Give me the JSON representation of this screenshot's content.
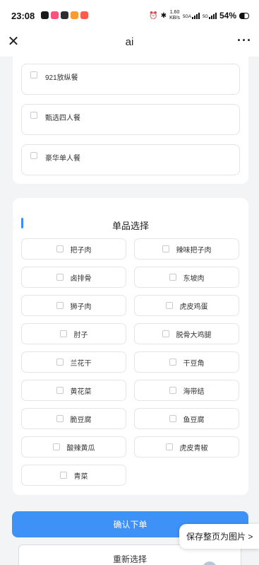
{
  "status_bar": {
    "time": "23:08",
    "net_speed": "1.60",
    "net_unit": "KB/s",
    "net_5ga": "5GA",
    "net_5g": "5G",
    "battery": "54%",
    "app_icon_colors": [
      "#1a1a1a",
      "#ff4f7a",
      "#2d2d2d",
      "#ff9a2e",
      "#ff5a4a"
    ]
  },
  "nav": {
    "title": "ai",
    "close_icon": "close-icon",
    "more_icon": "more-icon"
  },
  "combos": {
    "items": [
      {
        "label": "921放纵餐"
      },
      {
        "label": "甄选四人餐"
      },
      {
        "label": "豪华单人餐"
      }
    ]
  },
  "single": {
    "title": "单品选择",
    "items": [
      {
        "label": "把子肉"
      },
      {
        "label": "辣味把子肉"
      },
      {
        "label": "卤排骨"
      },
      {
        "label": "东坡肉"
      },
      {
        "label": "狮子肉"
      },
      {
        "label": "虎皮鸡蛋"
      },
      {
        "label": "肘子"
      },
      {
        "label": "脱骨大鸡腿"
      },
      {
        "label": "兰花干"
      },
      {
        "label": "干豆角"
      },
      {
        "label": "黄花菜"
      },
      {
        "label": "海带结"
      },
      {
        "label": "脆豆腐"
      },
      {
        "label": "鱼豆腐"
      },
      {
        "label": "酸辣黄瓜"
      },
      {
        "label": "虎皮青椒"
      },
      {
        "label": "青菜"
      }
    ]
  },
  "actions": {
    "confirm_label": "确认下单",
    "reset_label": "重新选择",
    "save_image_label": "保存整页为图片 >"
  },
  "colors": {
    "accent": "#3d91f7",
    "background": "#f3f4f6"
  }
}
